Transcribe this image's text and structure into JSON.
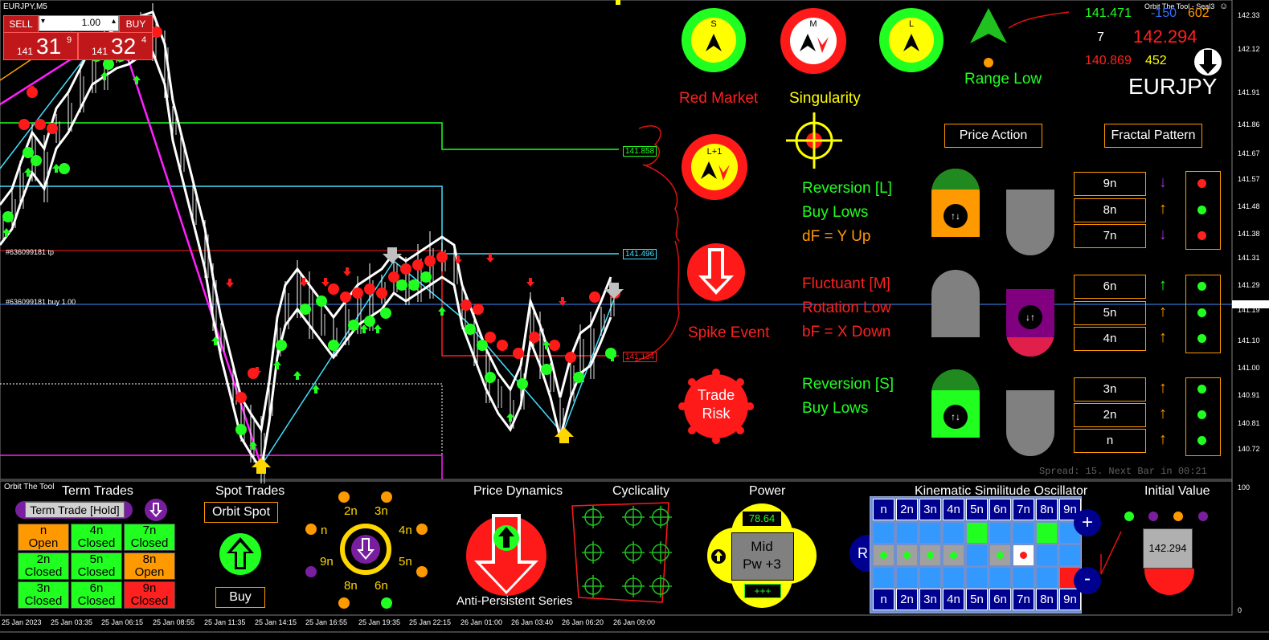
{
  "window": {
    "symbol_title": "EURJPY,M5",
    "indicator_name": "Orbit The Tool - Seal3"
  },
  "one_click": {
    "sell_label": "SELL",
    "buy_label": "BUY",
    "lot": "1.00",
    "sell_price_small": "141",
    "sell_price_big": "31",
    "sell_price_sup": "9",
    "buy_price_small": "141",
    "buy_price_big": "32",
    "buy_price_sup": "4"
  },
  "price_axis": [
    "142.33",
    "142.12",
    "141.91",
    "141.86",
    "141.67",
    "141.57",
    "141.48",
    "141.38",
    "141.31",
    "141.29",
    "141.19",
    "141.10",
    "141.00",
    "140.91",
    "140.81",
    "140.72"
  ],
  "time_axis": [
    "25 Jan 2023",
    "25 Jan 03:35",
    "25 Jan 06:15",
    "25 Jan 08:55",
    "25 Jan 11:35",
    "25 Jan 14:15",
    "25 Jan 16:55",
    "25 Jan 19:35",
    "25 Jan 22:15",
    "26 Jan 01:00",
    "26 Jan 03:40",
    "26 Jan 06:20",
    "26 Jan 09:00"
  ],
  "lower_axis_max": "100",
  "lower_axis_min": "0",
  "level_labels": {
    "green": "141.858",
    "cyan": "141.496",
    "red": "141.134"
  },
  "trade_lines": {
    "tp": "#636099181 tp",
    "buy": "#636099181 buy 1.00"
  },
  "info": {
    "hi": "141.471",
    "blue_val": "-150",
    "orange_val": "602",
    "count": "7",
    "price": "142.294",
    "low": "140.869",
    "yellow_val": "452",
    "pair": "EURJPY"
  },
  "signals": {
    "s_label": "S",
    "m_label": "M",
    "l_label": "L",
    "l1_label": "L+1",
    "range_low": "Range Low",
    "red_market": "Red Market",
    "singularity": "Singularity",
    "spike_event": "Spike Event",
    "trade_risk_line1": "Trade",
    "trade_risk_line2": "Risk"
  },
  "buttons": {
    "price_action": "Price Action",
    "fractal_pattern": "Fractal Pattern"
  },
  "analysis": {
    "l_title": "Reversion [L]",
    "l_line2": "Buy Lows",
    "l_line3": "dF = Y Up",
    "m_title": "Fluctuant [M]",
    "m_line2": "Rotation Low",
    "m_line3": "bF = X Down",
    "s_title": "Reversion [S]",
    "s_line2": "Buy Lows"
  },
  "fractals": [
    {
      "label": "9n",
      "arrow": "down",
      "arrow_color": "#9933cc",
      "dot": "#ff2020"
    },
    {
      "label": "8n",
      "arrow": "up",
      "arrow_color": "#ff9900",
      "dot": "#20ff20"
    },
    {
      "label": "7n",
      "arrow": "down",
      "arrow_color": "#9933cc",
      "dot": "#ff2020"
    },
    {
      "label": "6n",
      "arrow": "up",
      "arrow_color": "#20ff20",
      "dot": "#20ff20"
    },
    {
      "label": "5n",
      "arrow": "up",
      "arrow_color": "#ff9900",
      "dot": "#20ff20"
    },
    {
      "label": "4n",
      "arrow": "up",
      "arrow_color": "#ff9900",
      "dot": "#20ff20"
    },
    {
      "label": "3n",
      "arrow": "up",
      "arrow_color": "#ff9900",
      "dot": "#20ff20"
    },
    {
      "label": "2n",
      "arrow": "up",
      "arrow_color": "#ff9900",
      "dot": "#20ff20"
    },
    {
      "label": "n",
      "arrow": "up",
      "arrow_color": "#ff9900",
      "dot": "#20ff20"
    }
  ],
  "spread": "Spread: 15. Next Bar in 00:21",
  "bottom": {
    "tool_name": "Orbit The Tool",
    "term_trades_title": "Term Trades",
    "term_trade_hold": "Term Trade [Hold]",
    "term_cells": [
      {
        "l1": "n",
        "l2": "Open",
        "bg": "#ff9900"
      },
      {
        "l1": "4n",
        "l2": "Closed",
        "bg": "#20ff20"
      },
      {
        "l1": "7n",
        "l2": "Closed",
        "bg": "#20ff20"
      },
      {
        "l1": "2n",
        "l2": "Closed",
        "bg": "#20ff20"
      },
      {
        "l1": "5n",
        "l2": "Closed",
        "bg": "#20ff20"
      },
      {
        "l1": "8n",
        "l2": "Open",
        "bg": "#ff9900"
      },
      {
        "l1": "3n",
        "l2": "Closed",
        "bg": "#20ff20"
      },
      {
        "l1": "6n",
        "l2": "Closed",
        "bg": "#20ff20"
      },
      {
        "l1": "9n",
        "l2": "Closed",
        "bg": "#ff2020"
      }
    ],
    "spot_trades_title": "Spot Trades",
    "orbit_spot": "Orbit Spot",
    "buy_label": "Buy",
    "orbit_labels": {
      "n2": "2n",
      "n3": "3n",
      "n": "n",
      "n4": "4n",
      "n9": "9n",
      "n5": "5n",
      "n8": "8n",
      "n6": "6n"
    },
    "price_dynamics_title": "Price Dynamics",
    "anti_persistent": "Anti-Persistent Series",
    "cyclicality_title": "Cyclicality",
    "power_title": "Power",
    "power_value": "78.64",
    "power_mid": "Mid",
    "power_pw": "Pw +3",
    "power_bar": "+++",
    "kso_title": "Kinematic Similitude Oscillator",
    "kso_headers": [
      "n",
      "2n",
      "3n",
      "4n",
      "5n",
      "6n",
      "7n",
      "8n",
      "9n"
    ],
    "kso_plus": "+",
    "kso_minus": "-",
    "kso_r": "R",
    "initial_value_title": "Initial Value",
    "initial_value": "142.294"
  }
}
